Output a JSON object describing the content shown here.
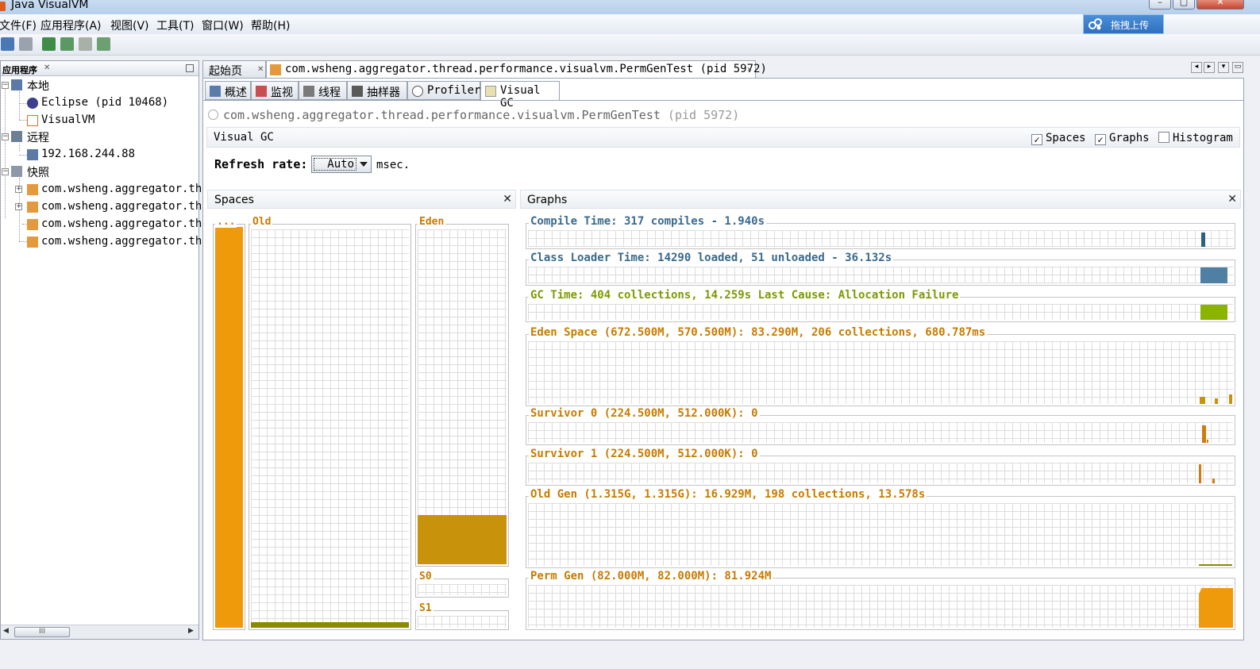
{
  "window": {
    "title": "Java VisualVM"
  },
  "menu": [
    "文件(F)",
    "应用程序(A)",
    "视图(V)",
    "工具(T)",
    "窗口(W)",
    "帮助(H)"
  ],
  "upload_button": "拖拽上传",
  "apps_panel": {
    "title": "应用程序",
    "local": "本地",
    "local_items": [
      "Eclipse (pid 10468)",
      "VisualVM"
    ],
    "remote": "远程",
    "remote_items": [
      "192.168.244.88"
    ],
    "snapshots": "快照",
    "snapshot_items": [
      "com.wsheng.aggregator.thr",
      "com.wsheng.aggregator.thr",
      "com.wsheng.aggregator.thr",
      "com.wsheng.aggregator.thr"
    ],
    "scroll_thumb": "III"
  },
  "doc_tabs": [
    "起始页",
    "com.wsheng.aggregator.thread.performance.visualvm.PermGenTest (pid 5972)"
  ],
  "sub_tabs": [
    "概述",
    "监视",
    "线程",
    "抽样器",
    "Profiler",
    "Visual GC"
  ],
  "process": {
    "name": "com.wsheng.aggregator.thread.performance.visualvm.PermGenTest",
    "pid": "(pid 5972)"
  },
  "visual_gc": {
    "title": "Visual GC",
    "checkboxes": [
      {
        "label": "Spaces",
        "checked": true
      },
      {
        "label": "Graphs",
        "checked": true
      },
      {
        "label": "Histogram",
        "checked": false
      }
    ],
    "refresh_label": "Refresh rate:",
    "refresh_value": "Auto",
    "refresh_unit": "msec."
  },
  "spaces": {
    "title": "Spaces",
    "perm_label": "...",
    "old_label": "Old",
    "eden_label": "Eden",
    "s0_label": "S0",
    "s1_label": "S1",
    "fill_fraction": {
      "perm": 0.999,
      "old": 0.013,
      "eden": 0.145,
      "s0": 0.0,
      "s1": 0.0
    }
  },
  "graphs": {
    "title": "Graphs",
    "rows": [
      "Compile Time: 317 compiles - 1.940s",
      "Class Loader Time: 14290 loaded, 51 unloaded - 36.132s",
      "GC Time: 404 collections, 14.259s  Last Cause: Allocation Failure",
      "Eden Space (672.500M, 570.500M): 83.290M, 206 collections, 680.787ms",
      "Survivor 0 (224.500M, 512.000K): 0",
      "Survivor 1 (224.500M, 512.000K): 0",
      "Old Gen (1.315G, 1.315G): 16.929M, 198 collections, 13.578s",
      "Perm Gen (82.000M, 82.000M): 81.924M"
    ]
  },
  "colors": {
    "orange": "#ee9a0a",
    "dark_gold": "#c8920a",
    "olive": "#8a8a00",
    "blue": "#4f7fa2",
    "green": "#8ab400"
  }
}
